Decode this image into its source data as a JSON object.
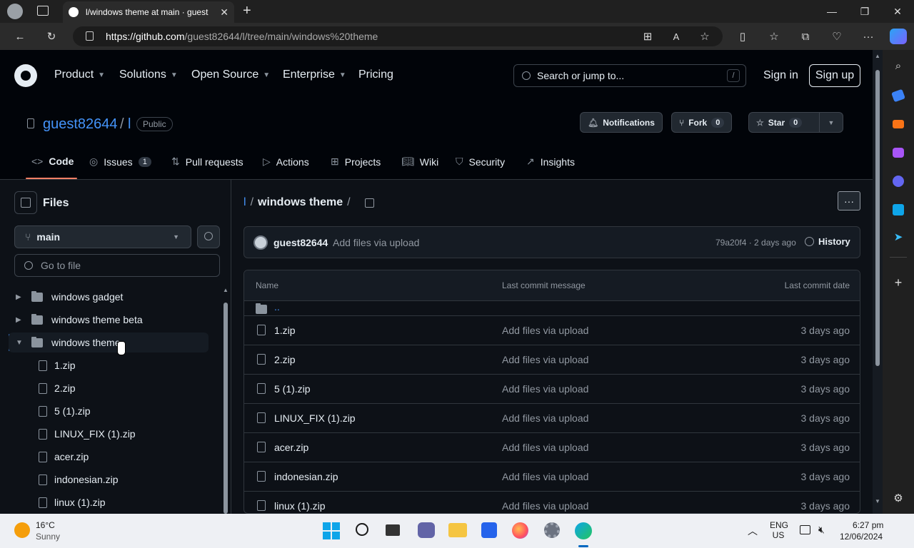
{
  "browser": {
    "tab_title": "l/windows theme at main · guest",
    "url_host": "https://github.com",
    "url_path": "/guest82644/l/tree/main/windows%20theme"
  },
  "header": {
    "nav": [
      "Product",
      "Solutions",
      "Open Source",
      "Enterprise",
      "Pricing"
    ],
    "search_placeholder": "Search or jump to...",
    "search_kbd": "/",
    "sign_in": "Sign in",
    "sign_up": "Sign up"
  },
  "repo": {
    "owner": "guest82644",
    "separator": "/",
    "name": "l",
    "visibility": "Public",
    "notifications": "Notifications",
    "fork_label": "Fork",
    "fork_count": "0",
    "star_label": "Star",
    "star_count": "0",
    "tabs": [
      {
        "label": "Code"
      },
      {
        "label": "Issues",
        "count": "1"
      },
      {
        "label": "Pull requests"
      },
      {
        "label": "Actions"
      },
      {
        "label": "Projects"
      },
      {
        "label": "Wiki"
      },
      {
        "label": "Security"
      },
      {
        "label": "Insights"
      }
    ]
  },
  "files_pane": {
    "title": "Files",
    "branch": "main",
    "goto_placeholder": "Go to file",
    "tree": [
      {
        "label": "windows gadget",
        "type": "folder"
      },
      {
        "label": "windows theme beta",
        "type": "folder"
      },
      {
        "label": "windows theme",
        "type": "folder-open"
      },
      {
        "label": "1.zip",
        "type": "file"
      },
      {
        "label": "2.zip",
        "type": "file"
      },
      {
        "label": "5 (1).zip",
        "type": "file"
      },
      {
        "label": "LINUX_FIX (1).zip",
        "type": "file"
      },
      {
        "label": "acer.zip",
        "type": "file"
      },
      {
        "label": "indonesian.zip",
        "type": "file"
      },
      {
        "label": "linux (1).zip",
        "type": "file"
      }
    ]
  },
  "main": {
    "crumb_repo": "l",
    "crumb_sep": "/",
    "crumb_dir": "windows theme",
    "crumb_trail": "/",
    "commit_author": "guest82644",
    "commit_message": "Add files via upload",
    "commit_meta": "79a20f4 · 2 days ago",
    "history": "History",
    "col_name": "Name",
    "col_msg": "Last commit message",
    "col_date": "Last commit date",
    "parent_dir": "..",
    "files": [
      {
        "name": "1.zip",
        "msg": "Add files via upload",
        "date": "3 days ago"
      },
      {
        "name": "2.zip",
        "msg": "Add files via upload",
        "date": "3 days ago"
      },
      {
        "name": "5 (1).zip",
        "msg": "Add files via upload",
        "date": "3 days ago"
      },
      {
        "name": "LINUX_FIX (1).zip",
        "msg": "Add files via upload",
        "date": "3 days ago"
      },
      {
        "name": "acer.zip",
        "msg": "Add files via upload",
        "date": "3 days ago"
      },
      {
        "name": "indonesian.zip",
        "msg": "Add files via upload",
        "date": "3 days ago"
      },
      {
        "name": "linux (1).zip",
        "msg": "Add files via upload",
        "date": "3 days ago"
      }
    ]
  },
  "taskbar": {
    "temp": "16°C",
    "weather": "Sunny",
    "lang": "ENG",
    "region": "US",
    "time": "6:27 pm",
    "date": "12/06/2024"
  },
  "colors": {
    "accent_blue": "#4493f8",
    "active_tab_underline": "#f78166"
  }
}
